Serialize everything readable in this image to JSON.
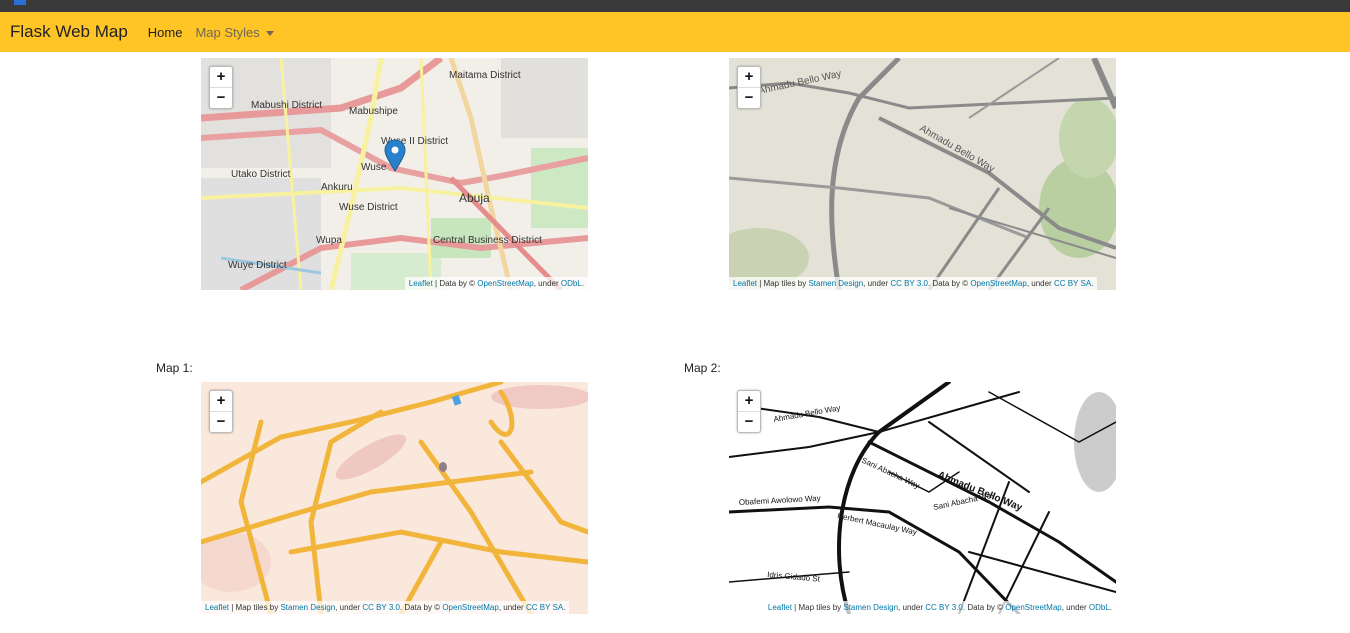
{
  "navbar": {
    "brand": "Flask Web Map",
    "home": "Home",
    "map_styles": "Map Styles"
  },
  "labels": {
    "map1": "Map 1:",
    "map2": "Map 2:"
  },
  "zoom": {
    "in": "+",
    "out": "−"
  },
  "maps": {
    "osm": {
      "places": [
        "Maitama District",
        "Mabushi District",
        "Mabushipe",
        "Wuse II District",
        "Utako District",
        "Wuse",
        "Ankuru",
        "Wuse District",
        "Abuja",
        "Central Business District",
        "Wupa",
        "Wuye District"
      ],
      "attr": {
        "leaflet": "Leaflet",
        "sep1": " | Data by © ",
        "osm": "OpenStreetMap",
        "sep2": ", under ",
        "odbl": "ODbL",
        "end": "."
      }
    },
    "terrain": {
      "streets": [
        "Ahmadu Bello Way",
        "Ahmadu Bello Way"
      ],
      "attr": {
        "leaflet": "Leaflet",
        "sep1": " | Map tiles by ",
        "stamen": "Stamen Design",
        "sep2": ", under ",
        "ccby": "CC BY 3.0",
        "sep3": ". Data by © ",
        "osm": "OpenStreetMap",
        "sep4": ", under ",
        "ccbysa": "CC BY SA",
        "end": "."
      }
    },
    "watercolor": {
      "attr": {
        "leaflet": "Leaflet",
        "sep1": " | Map tiles by ",
        "stamen": "Stamen Design",
        "sep2": ", under ",
        "ccby": "CC BY 3.0",
        "sep3": ". Data by © ",
        "osm": "OpenStreetMap",
        "sep4": ", under ",
        "ccbysa": "CC BY SA",
        "end": "."
      }
    },
    "toner": {
      "streets": [
        "Ahmadu Bello Way",
        "Ahmadu Bello Way",
        "Obafemi Awolowo Way",
        "Herbert Macaulay Way",
        "Sani Abacha Way",
        "Sani Abacha Way",
        "Idris Gidado St"
      ],
      "attr": {
        "leaflet": "Leaflet",
        "sep1": " | Map tiles by ",
        "stamen": "Stamen Design",
        "sep2": ", under ",
        "ccby": "CC BY 3.0",
        "sep3": ". Data by © ",
        "osm": "OpenStreetMap",
        "sep4": ", under ",
        "odbl": "ODbL",
        "end": "."
      }
    }
  },
  "colors": {
    "navbar": "#ffc425",
    "link": "#0078a8",
    "marker": "#2a81cb"
  }
}
